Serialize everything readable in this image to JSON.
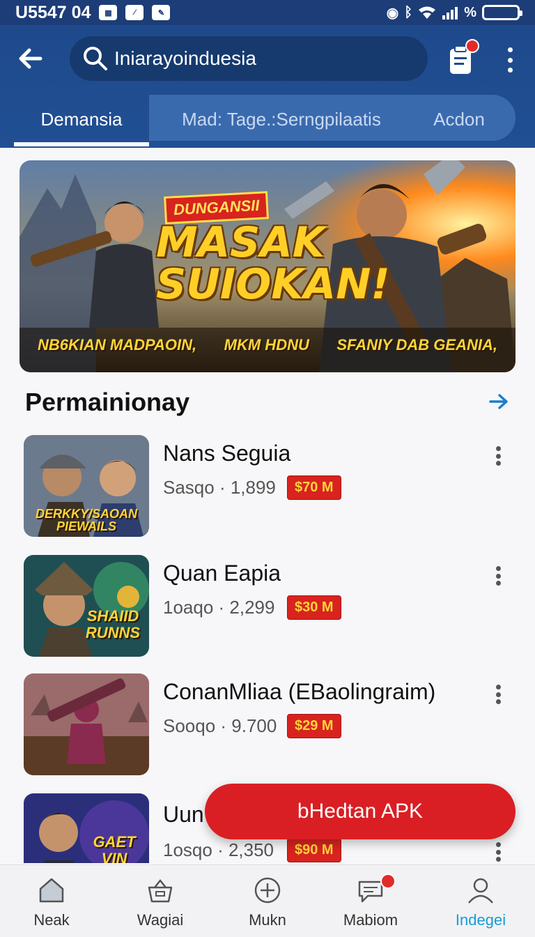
{
  "status_bar": {
    "time": "U5547 04",
    "battery": "%"
  },
  "header": {
    "search_value": "Iniarayoinduesia",
    "icons": {
      "back": "arrow-left-icon",
      "search": "search-icon",
      "notifications": "clipboard-icon",
      "more": "more-vertical-icon"
    }
  },
  "tabs": [
    {
      "label": "Demansia",
      "active": true
    },
    {
      "label": "Mad: Tage.:Serngpilaatis",
      "active": false
    },
    {
      "label": "Acdon",
      "active": false
    }
  ],
  "banner": {
    "badge": "DUNGANSII",
    "title_line1": "MASAK",
    "title_line2": "SUIOKAN!",
    "captions": [
      "NB6KIAN MADPAOIN,",
      "MKM HDNU",
      "SFANIY DAB GEANIA,"
    ]
  },
  "section": {
    "title": "Permainionay"
  },
  "games": [
    {
      "name": "Nans Seguia",
      "meta": "Sasqo · 1,899",
      "price": "$70 M",
      "thumb_caption": "DERKKY/SAOAN PIEWAILS"
    },
    {
      "name": "Quan Eapia",
      "meta": "1oaqo · 2,299",
      "price": "$30 M",
      "thumb_caption": "SHAIID RUNNS"
    },
    {
      "name": "ConanMliaa (EBaolingraim)",
      "meta": "Sooqo · 9.700",
      "price": "$29 M",
      "thumb_caption": ""
    },
    {
      "name": "Uun",
      "meta": "1osqo · 2,350",
      "price": "$90 M",
      "thumb_caption": "GAET VIN"
    }
  ],
  "cta": {
    "label": "bHedtan APK"
  },
  "bottom_nav": [
    {
      "label": "Neak",
      "icon": "home-icon",
      "active": false
    },
    {
      "label": "Wagiai",
      "icon": "basket-icon",
      "active": false
    },
    {
      "label": "Mukn",
      "icon": "plus-circle-icon",
      "active": false
    },
    {
      "label": "Mabiom",
      "icon": "chat-icon",
      "active": false
    },
    {
      "label": "Indegei",
      "icon": "profile-icon",
      "active": true
    }
  ],
  "colors": {
    "header": "#1e4a8c",
    "accent_red": "#d91f24",
    "active_nav": "#1a9bd7"
  }
}
